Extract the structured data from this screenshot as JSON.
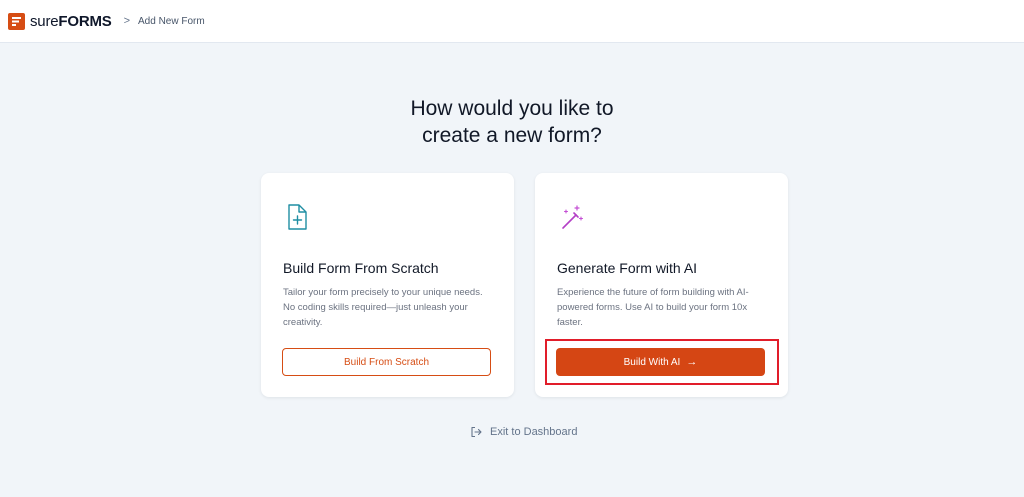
{
  "header": {
    "logo_sure": "sure",
    "logo_forms": "FORMS",
    "breadcrumb_separator": ">",
    "breadcrumb_current": "Add New Form"
  },
  "main": {
    "heading_line1": "How would you like to",
    "heading_line2": "create a new form?"
  },
  "cards": {
    "scratch": {
      "icon": "file-plus-icon",
      "title": "Build Form From Scratch",
      "description": "Tailor your form precisely to your unique needs. No coding skills required—just unleash your creativity.",
      "button_label": "Build From Scratch"
    },
    "ai": {
      "icon": "magic-wand-icon",
      "title": "Generate Form with AI",
      "description": "Experience the future of form building with AI-powered forms. Use AI to build your form 10x faster.",
      "button_label": "Build With AI",
      "button_arrow": "→"
    }
  },
  "footer": {
    "exit_label": "Exit to Dashboard",
    "exit_icon": "log-out-icon"
  },
  "colors": {
    "brand": "#d64d14",
    "background": "#f1f5f9",
    "highlight": "#e11d2a"
  }
}
